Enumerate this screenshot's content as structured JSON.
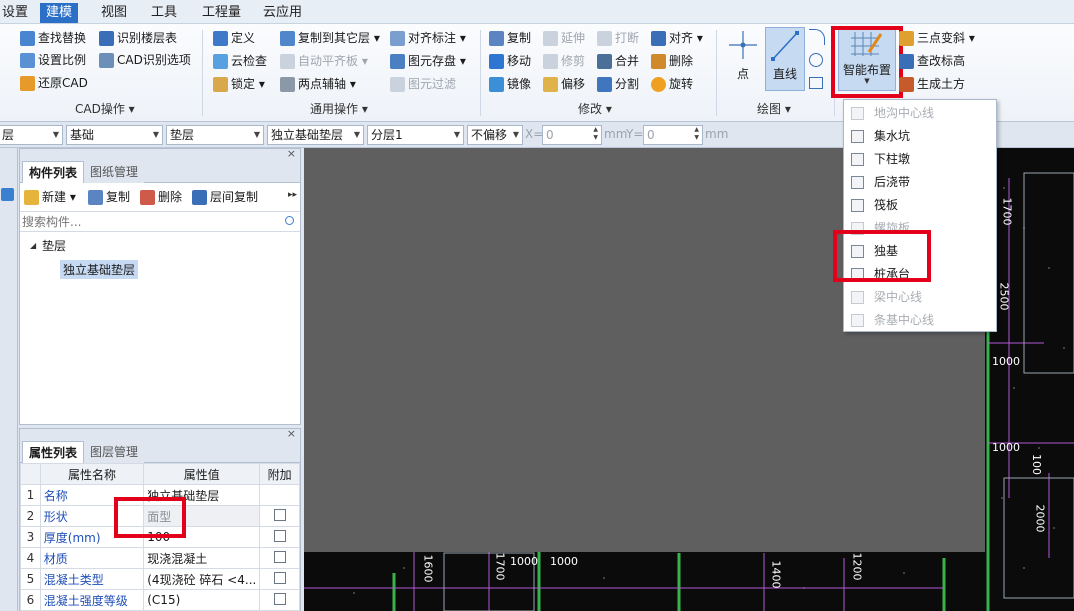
{
  "menubar": {
    "items": [
      "设置",
      "建模",
      "视图",
      "工具",
      "工程量",
      "云应用"
    ],
    "active_index": 1
  },
  "ribbon": {
    "cad_group": {
      "title": "CAD操作 ▾",
      "items": [
        "查找替换",
        "识别楼层表",
        "设置比例",
        "CAD识别选项",
        "还原CAD"
      ]
    },
    "common_group": {
      "title": "通用操作 ▾",
      "items": [
        "定义",
        "复制到其它层 ▾",
        "对齐标注 ▾",
        "云检查",
        "自动平齐板 ▾",
        "图元存盘 ▾",
        "锁定 ▾",
        "两点辅轴 ▾",
        "图元过滤"
      ]
    },
    "modify_group": {
      "title": "修改 ▾",
      "items": [
        "复制",
        "延伸",
        "打断",
        "对齐 ▾",
        "移动",
        "修剪",
        "合并",
        "删除",
        "镜像",
        "偏移",
        "分割",
        "旋转"
      ]
    },
    "draw_group": {
      "title": "绘图 ▾",
      "point": "点",
      "line": "直线"
    },
    "smart_place": "智能布置",
    "right_items": [
      "三点变斜 ▾",
      "查改标高",
      "生成土方"
    ]
  },
  "combos": {
    "floor": "层",
    "category": "基础",
    "type": "垫层",
    "component": "独立基础垫层",
    "sublayer": "分层1",
    "offset": "不偏移",
    "x_label": "X=",
    "x_value": "0",
    "x_unit": "mm",
    "y_label": "Y=",
    "y_value": "0",
    "y_unit": "mm"
  },
  "component_panel": {
    "tabs": [
      "构件列表",
      "图纸管理"
    ],
    "toolbar": [
      "新建 ▾",
      "复制",
      "删除",
      "层间复制"
    ],
    "more": "▸▸",
    "search_placeholder": "搜索构件...",
    "tree_root": "垫层",
    "tree_child": "独立基础垫层"
  },
  "property_panel": {
    "tabs": [
      "属性列表",
      "图层管理"
    ],
    "headers": [
      "属性名称",
      "属性值",
      "附加"
    ],
    "rows": [
      {
        "num": "1",
        "name": "名称",
        "value": "独立基础垫层",
        "check": false
      },
      {
        "num": "2",
        "name": "形状",
        "value": "面型",
        "check": true
      },
      {
        "num": "3",
        "name": "厚度(mm)",
        "value": "100",
        "check": true
      },
      {
        "num": "4",
        "name": "材质",
        "value": "现浇混凝土",
        "check": true
      },
      {
        "num": "5",
        "name": "混凝土类型",
        "value": "(4现浇砼 碎石 <4...",
        "check": true
      },
      {
        "num": "6",
        "name": "混凝土强度等级",
        "value": "(C15)",
        "check": true
      }
    ]
  },
  "dropdown": {
    "items": [
      {
        "label": "地沟中心线",
        "disabled": true
      },
      {
        "label": "集水坑",
        "disabled": false
      },
      {
        "label": "下柱墩",
        "disabled": false
      },
      {
        "label": "后浇带",
        "disabled": false
      },
      {
        "label": "筏板",
        "disabled": false
      },
      {
        "label": "螺旋板",
        "disabled": true
      },
      {
        "label": "独基",
        "disabled": false
      },
      {
        "label": "桩承台",
        "disabled": false
      },
      {
        "label": "梁中心线",
        "disabled": true
      },
      {
        "label": "条基中心线",
        "disabled": true
      }
    ]
  },
  "cad_dims": [
    "1700",
    "2500",
    "1000",
    "1000",
    "100",
    "2000",
    "1600",
    "1700",
    "1000",
    "1000",
    "1400",
    "1200"
  ],
  "colors": {
    "active_tab": "#2b6fc6",
    "highlight": "#e3001b",
    "canvas_gray": "#5f5f5f"
  }
}
